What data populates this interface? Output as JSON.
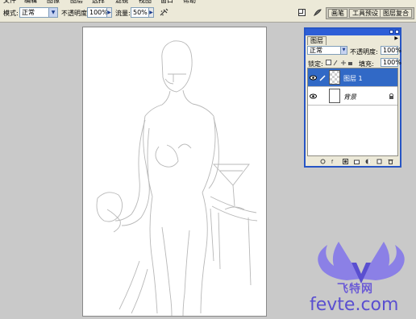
{
  "menubar": {
    "items": [
      "文件",
      "编辑",
      "图像",
      "图层",
      "选择",
      "滤镜",
      "视图",
      "窗口",
      "帮助"
    ]
  },
  "options_bar": {
    "mode_label": "模式:",
    "mode_value": "正常",
    "opacity_label": "不透明度:",
    "opacity_value": "100%",
    "flow_label": "流量:",
    "flow_value": "50%",
    "palette_wells": [
      "画笔",
      "工具预设",
      "图层复合"
    ]
  },
  "layers_panel": {
    "tab_label": "图层",
    "blend_mode": "正常",
    "opacity_label": "不透明度:",
    "opacity_value": "100%",
    "lock_label": "锁定:",
    "fill_label": "填充:",
    "fill_value": "100%",
    "layers": [
      {
        "name": "图层 1",
        "active": true
      },
      {
        "name": "背景",
        "active": false,
        "locked": true
      }
    ]
  },
  "watermark": {
    "cn_text": "飞特网",
    "en_text": "fevte.com"
  },
  "colors": {
    "workspace": "#c9c9c9",
    "toolbar": "#ece9d8",
    "panel_border": "#2755c5",
    "active_layer": "#3169c6",
    "watermark": "#5a4fd0"
  }
}
